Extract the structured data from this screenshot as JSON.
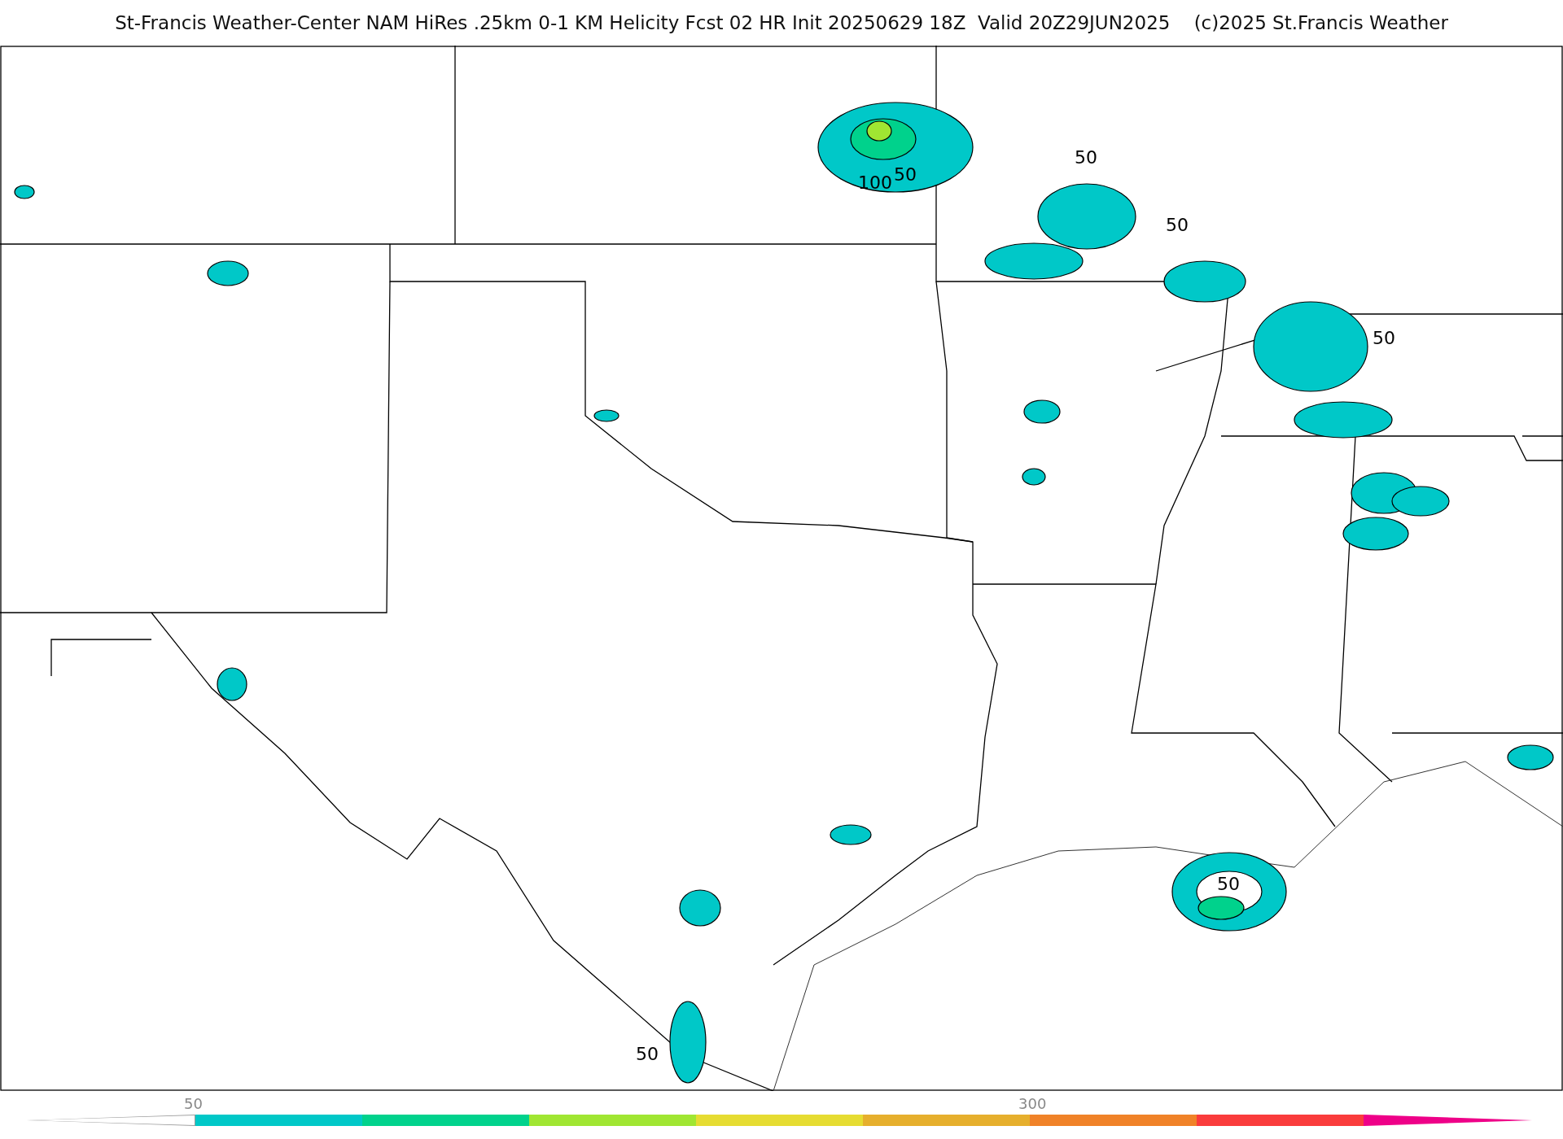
{
  "title": "St-Francis Weather-Center NAM HiRes .25km 0-1 KM Helicity Fcst 02 HR Init 20250629 18Z  Valid 20Z29JUN2025    (c)2025 St.Francis Weather",
  "map": {
    "contour_labels": [
      {
        "text": "50"
      },
      {
        "text": "100"
      },
      {
        "text": "50"
      },
      {
        "text": "50"
      },
      {
        "text": "50"
      },
      {
        "text": "50"
      },
      {
        "text": "50"
      }
    ]
  },
  "colorbar": {
    "low_end": {
      "color": "#ffffff"
    },
    "high_end": {
      "color": "#ee0088"
    },
    "segments": [
      {
        "color": "#00c8c8",
        "tick": "50"
      },
      {
        "color": "#00d28c"
      },
      {
        "color": "#a0e632"
      },
      {
        "color": "#e6dc32"
      },
      {
        "color": "#e6af2d"
      },
      {
        "color": "#f08228",
        "tick": "300"
      },
      {
        "color": "#fa3c3c"
      }
    ]
  }
}
